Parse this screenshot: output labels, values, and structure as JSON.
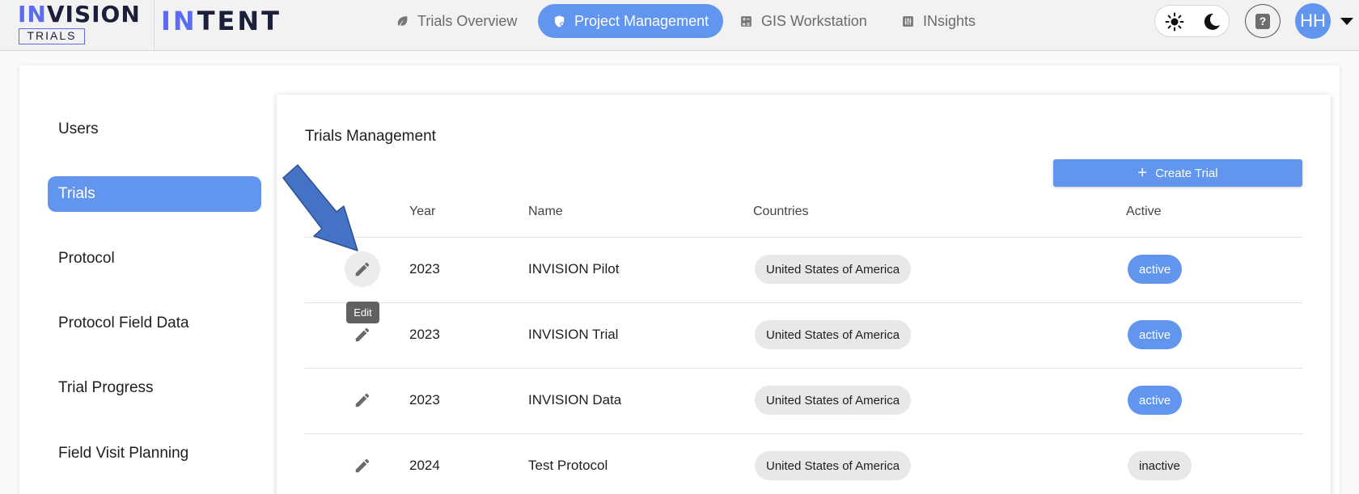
{
  "brand": {
    "name_accent": "IN",
    "name_rest": "VISION",
    "sub": "TRIALS",
    "product_accent": "IN",
    "product_rest": "TENT"
  },
  "nav": {
    "tabs": [
      {
        "label": "Trials Overview",
        "icon": "leaf-icon"
      },
      {
        "label": "Project Management",
        "icon": "shield-icon",
        "active": true
      },
      {
        "label": "GIS Workstation",
        "icon": "calculator-icon"
      },
      {
        "label": "INsights",
        "icon": "sliders-icon"
      }
    ],
    "theme": {
      "light_icon": "sun-icon",
      "dark_icon": "moon-icon"
    },
    "help_icon_text": "?",
    "user_initials": "HH"
  },
  "sidebar": {
    "items": [
      {
        "label": "Users"
      },
      {
        "label": "Trials",
        "active": true
      },
      {
        "label": "Protocol"
      },
      {
        "label": "Protocol Field Data"
      },
      {
        "label": "Trial Progress"
      },
      {
        "label": "Field Visit Planning"
      }
    ]
  },
  "trials": {
    "title": "Trials Management",
    "create_label": "Create Trial",
    "create_icon": "+",
    "columns": [
      "Year",
      "Name",
      "Countries",
      "Active"
    ],
    "rows": [
      {
        "year": "2023",
        "name": "INVISION Pilot",
        "country": "United States of America",
        "status": "active"
      },
      {
        "year": "2023",
        "name": "INVISION Trial",
        "country": "United States of America",
        "status": "active"
      },
      {
        "year": "2023",
        "name": "INVISION Data",
        "country": "United States of America",
        "status": "active"
      },
      {
        "year": "2024",
        "name": "Test Protocol",
        "country": "United States of America",
        "status": "inactive"
      }
    ],
    "edit_tooltip": "Edit"
  },
  "colors": {
    "accent": "#6195ee",
    "brand_blue": "#5b6cf0",
    "arrow": "#4472c4"
  }
}
